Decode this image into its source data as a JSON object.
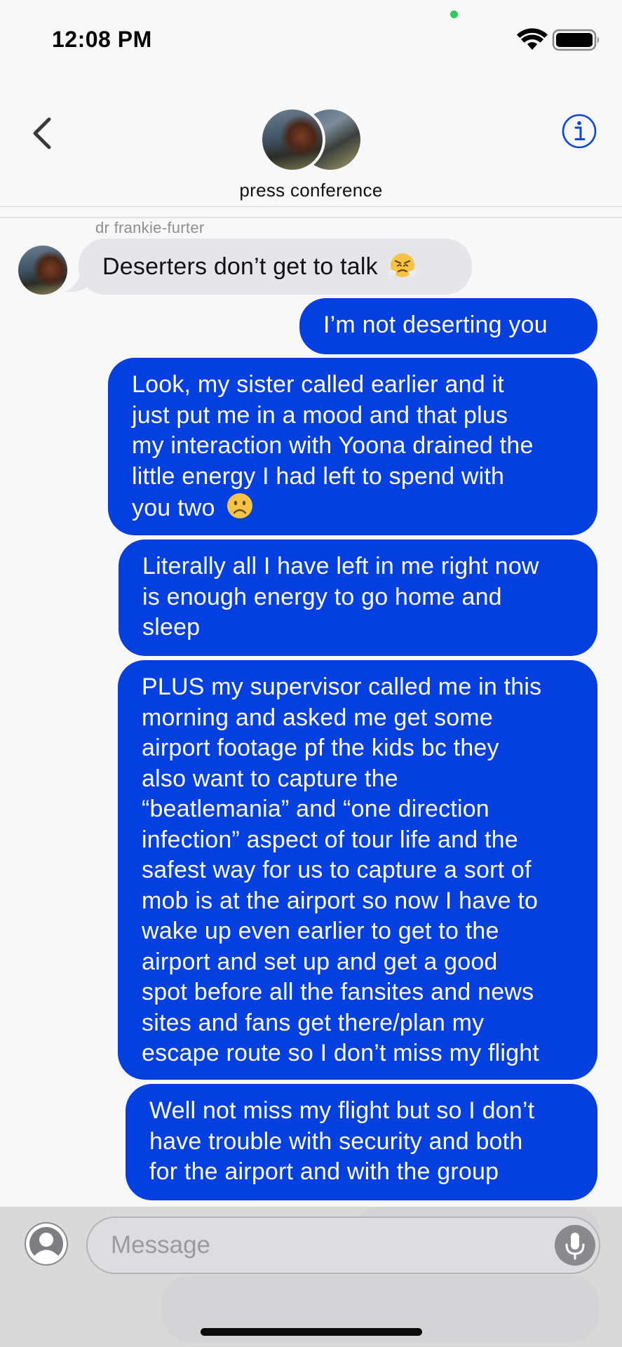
{
  "status_bar": {
    "time": "12:08 PM",
    "icons": [
      "wifi-icon",
      "battery-icon"
    ]
  },
  "header": {
    "group_name": "press conference",
    "back_icon": "chevron-left-icon",
    "info_icon": "info-icon"
  },
  "accent_colors": {
    "outgoing_bubble": "#0440e0",
    "incoming_bubble": "#e6e5ea",
    "tint": "#0a47db"
  },
  "messages": [
    {
      "direction": "incoming",
      "sender": "dr frankie-furter",
      "text": "Deserters don’t get to talk",
      "emoji": "face-with-steam-from-nose"
    },
    {
      "direction": "outgoing",
      "text": "I’m not deserting you"
    },
    {
      "direction": "outgoing",
      "lines": [
        "Look, my sister called earlier and it",
        "just put me in a mood and that plus",
        "my interaction with Yoona drained the",
        "little energy I had left to spend with",
        "you two"
      ],
      "emoji": "frowning-face"
    },
    {
      "direction": "outgoing",
      "lines": [
        "Literally all I have left in me right now",
        "is enough energy to go home and",
        "sleep"
      ]
    },
    {
      "direction": "outgoing",
      "lines": [
        "PLUS my supervisor called me in this",
        "morning and asked me get some",
        "airport footage pf the kids bc they",
        "also want to capture the",
        "“beatlemania” and “one direction",
        "infection” aspect of tour life and the",
        "safest way for us to capture a sort of",
        "mob is at the airport so now I have to",
        "wake up even earlier to get to the",
        "airport and set up and get a good",
        "spot before all the fansites and news",
        "sites and fans get there/plan my",
        "escape route so I don’t miss my flight"
      ]
    },
    {
      "direction": "outgoing",
      "lines": [
        "Well not miss my flight but so I don’t",
        "have trouble with security and both",
        "for the airport and with the group"
      ]
    }
  ],
  "composer": {
    "placeholder": "Message",
    "contact_icon": "person-icon",
    "mic_icon": "microphone-icon"
  }
}
